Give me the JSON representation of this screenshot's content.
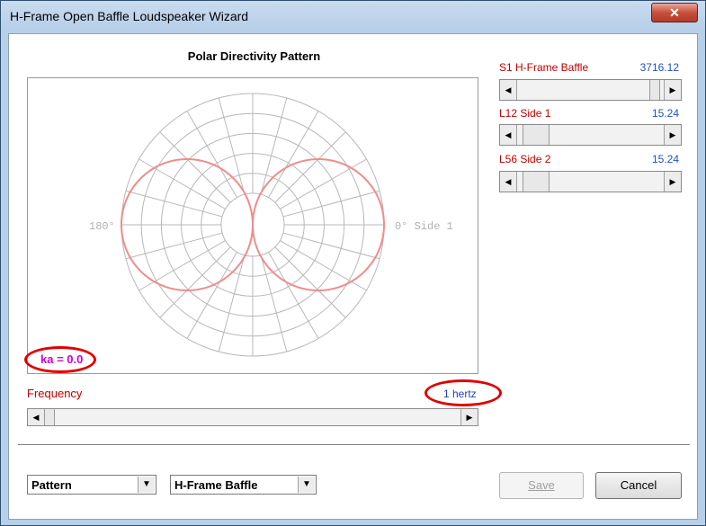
{
  "window": {
    "title": "H-Frame Open Baffle Loudspeaker Wizard",
    "close_symbol": "✕"
  },
  "chart": {
    "title": "Polar Directivity Pattern",
    "left_angle": "180°",
    "right_angle": "0° Side 1",
    "ka_label": "ka = 0.0",
    "colors": {
      "grid": "#b8b8b8",
      "pattern": "#f08c8c",
      "highlight": "#e00000"
    }
  },
  "chart_data": {
    "type": "polar",
    "title": "Polar Directivity Pattern",
    "angle_labels": [
      "0° Side 1",
      "180°"
    ],
    "pattern": "dipole figure-eight (|cos θ|), null at 90° and 270°",
    "ka": 0.0
  },
  "frequency": {
    "label": "Frequency",
    "value": "1 hertz",
    "slider_fraction": 0.0
  },
  "params": [
    {
      "label": "S1  H-Frame Baffle",
      "value": "3716.12",
      "slider_fraction": 0.97
    },
    {
      "label": "L12  Side 1",
      "value": "15.24",
      "slider_fraction": 0.05
    },
    {
      "label": "L56  Side 2",
      "value": "15.24",
      "slider_fraction": 0.05
    }
  ],
  "bottom": {
    "view_select": "Pattern",
    "source_select": "H-Frame Baffle",
    "save_label": "Save",
    "cancel_label": "Cancel"
  },
  "icons": {
    "scroll_left": "◀",
    "scroll_right": "▶",
    "dropdown": "▼"
  }
}
